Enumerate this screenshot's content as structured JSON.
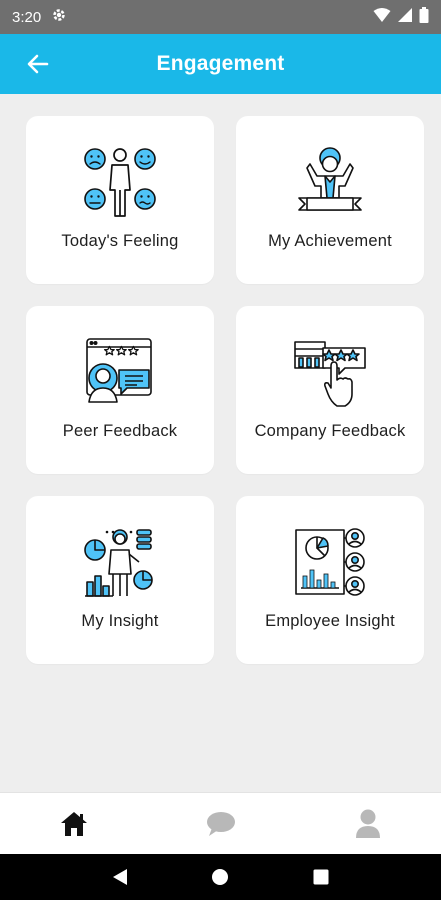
{
  "status_bar": {
    "time": "3:20",
    "icons": [
      "settings-gear-icon",
      "wifi-icon",
      "signal-icon",
      "battery-icon"
    ]
  },
  "app_bar": {
    "title": "Engagement",
    "back_icon": "arrow-left-icon"
  },
  "menu": [
    {
      "label": "Today's Feeling",
      "icon": "emotions-icon"
    },
    {
      "label": "My Achievement",
      "icon": "achievement-icon"
    },
    {
      "label": "Peer Feedback",
      "icon": "peer-feedback-icon"
    },
    {
      "label": "Company Feedback",
      "icon": "company-feedback-icon"
    },
    {
      "label": "My Insight",
      "icon": "my-insight-icon"
    },
    {
      "label": "Employee Insight",
      "icon": "employee-insight-icon"
    }
  ],
  "bottom_nav": {
    "items": [
      "home-icon",
      "chat-icon",
      "profile-icon"
    ],
    "active": "home-icon"
  },
  "system_nav": [
    "back-triangle-icon",
    "home-circle-icon",
    "recents-square-icon"
  ],
  "colors": {
    "accent": "#1ab8e8",
    "icon_fill": "#4fc3f7",
    "background": "#eeeeee",
    "card": "#ffffff"
  }
}
